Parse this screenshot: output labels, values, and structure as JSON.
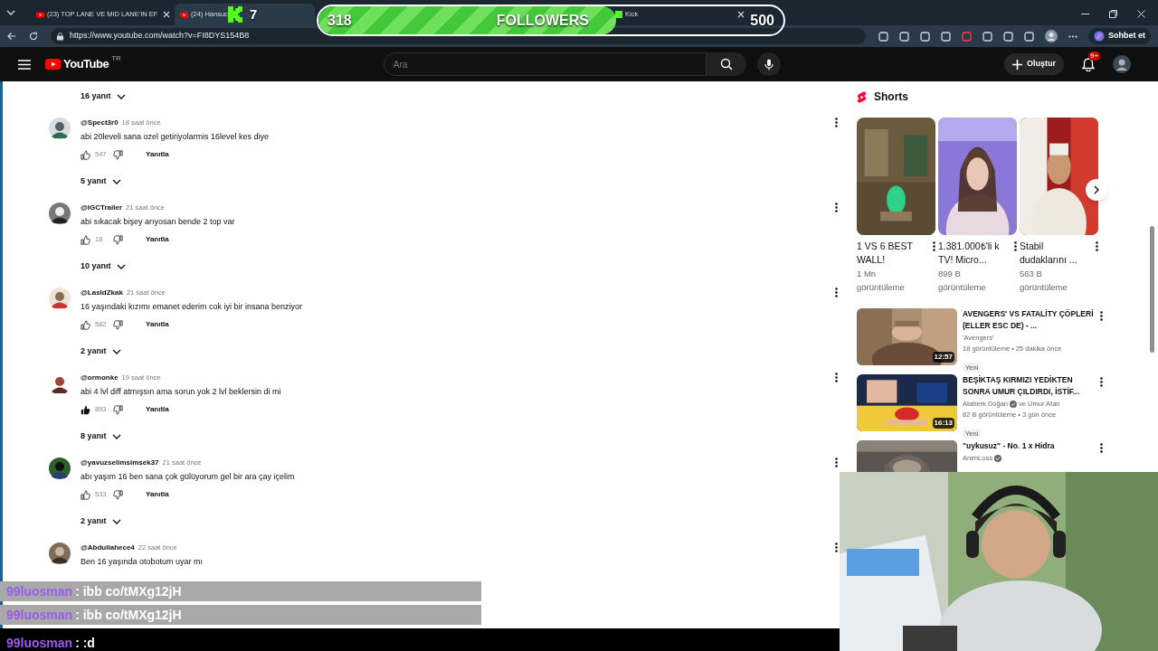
{
  "browser": {
    "tabs": [
      {
        "title": "(23) TOP LANE VE MID LANE'IN EF",
        "selected": false
      },
      {
        "title": "(24) Hansuc",
        "selected": true
      },
      {
        "title": "Kick",
        "selected": false
      }
    ],
    "url": "https://www.youtube.com/watch?v=FI8DYS154B8",
    "chat_button": "Sohbet et"
  },
  "followers_overlay": {
    "current": "318",
    "label": "FOLLOWERS",
    "goal": "500",
    "level": 0.64
  },
  "kick_overlay": {
    "count": "7"
  },
  "youtube_header": {
    "logo": "YouTube",
    "region": "TR",
    "search_placeholder": "Ara",
    "create_button": "Oluştur",
    "notifications": "9+"
  },
  "comments": {
    "top_replies": "16 yanıt",
    "items": [
      {
        "author": "@Spect3r0",
        "time": "18 saat önce",
        "text": "abi 20leveli sana ozel getiriyolarmis 16level kes diye",
        "likes": "547",
        "liked": false,
        "reply": "Yanıtla",
        "replies": "5 yanıt"
      },
      {
        "author": "@IGCTrailer",
        "time": "21 saat önce",
        "text": "abi sıkacak bişey arıyosan bende 2 top var",
        "likes": "18",
        "liked": false,
        "reply": "Yanıtla",
        "replies": "10 yanıt"
      },
      {
        "author": "@LasldZkak",
        "time": "21 saat önce",
        "text": "16 yaşındaki kızımı emanet ederim cok iyi bir insana benziyor",
        "likes": "582",
        "liked": false,
        "reply": "Yanıtla",
        "replies": "2 yanıt"
      },
      {
        "author": "@ormonke",
        "time": "19 saat önce",
        "text": "abi 4 lvl diff atmışsın ama sorun yok 2 lvl beklersin di mi",
        "likes": "893",
        "liked": true,
        "reply": "Yanıtla",
        "replies": "8 yanıt"
      },
      {
        "author": "@yavuzselimsimsek37",
        "time": "21 saat önce",
        "text": "abı yaşım 16 ben sana çok gülüyorum gel bir ara çay içelim",
        "likes": "533",
        "liked": false,
        "reply": "Yanıtla",
        "replies": "2 yanıt"
      },
      {
        "author": "@Abdullahece4",
        "time": "22 saat önce",
        "text": "Ben 16 yaşında otobotum uyar mı"
      }
    ]
  },
  "shorts": {
    "title": "Shorts",
    "items": [
      {
        "title": "1 VS 6 BEST WALL!",
        "views": "1 Mn görüntüleme"
      },
      {
        "title": "1.381.000₺'li k TV! Micro...",
        "views": "899 B görüntüleme"
      },
      {
        "title": "Stabil dudaklarını ...",
        "views": "563 B görüntüleme"
      }
    ]
  },
  "videos": [
    {
      "title": "AVENGERS' VS FATALİTY ÇÖPLERİ (ELLER ESC DE) - ...",
      "duration": "12:57",
      "channel": "'Avengers'",
      "verified": false,
      "meta": "18 görüntüleme • 25 dakika önce",
      "badge": "Yeni"
    },
    {
      "title": "BEŞİKTAŞ KIRMIZI YEDİKTEN SONRA UMUR ÇILDIRDI, İSTİF...",
      "duration": "16:13",
      "channel": "Ataberk Doğan",
      "verified": true,
      "channel_extra": "ve Umur Afan",
      "meta": "82 B görüntüleme • 3 gün önce",
      "badge": "Yeni"
    },
    {
      "title": "\"uykusuz\" - No. 1 x Hidra",
      "channel": "AnimLoss",
      "verified": true
    }
  ],
  "chat": [
    {
      "kind": "highlight",
      "user": "99luosman",
      "message": ": ibb co/tMXg12jH"
    },
    {
      "kind": "highlight",
      "user": "99luosman",
      "message": ": ibb co/tMXg12jH"
    },
    {
      "kind": "plain",
      "user": "99luosman",
      "message": ": :d"
    }
  ]
}
